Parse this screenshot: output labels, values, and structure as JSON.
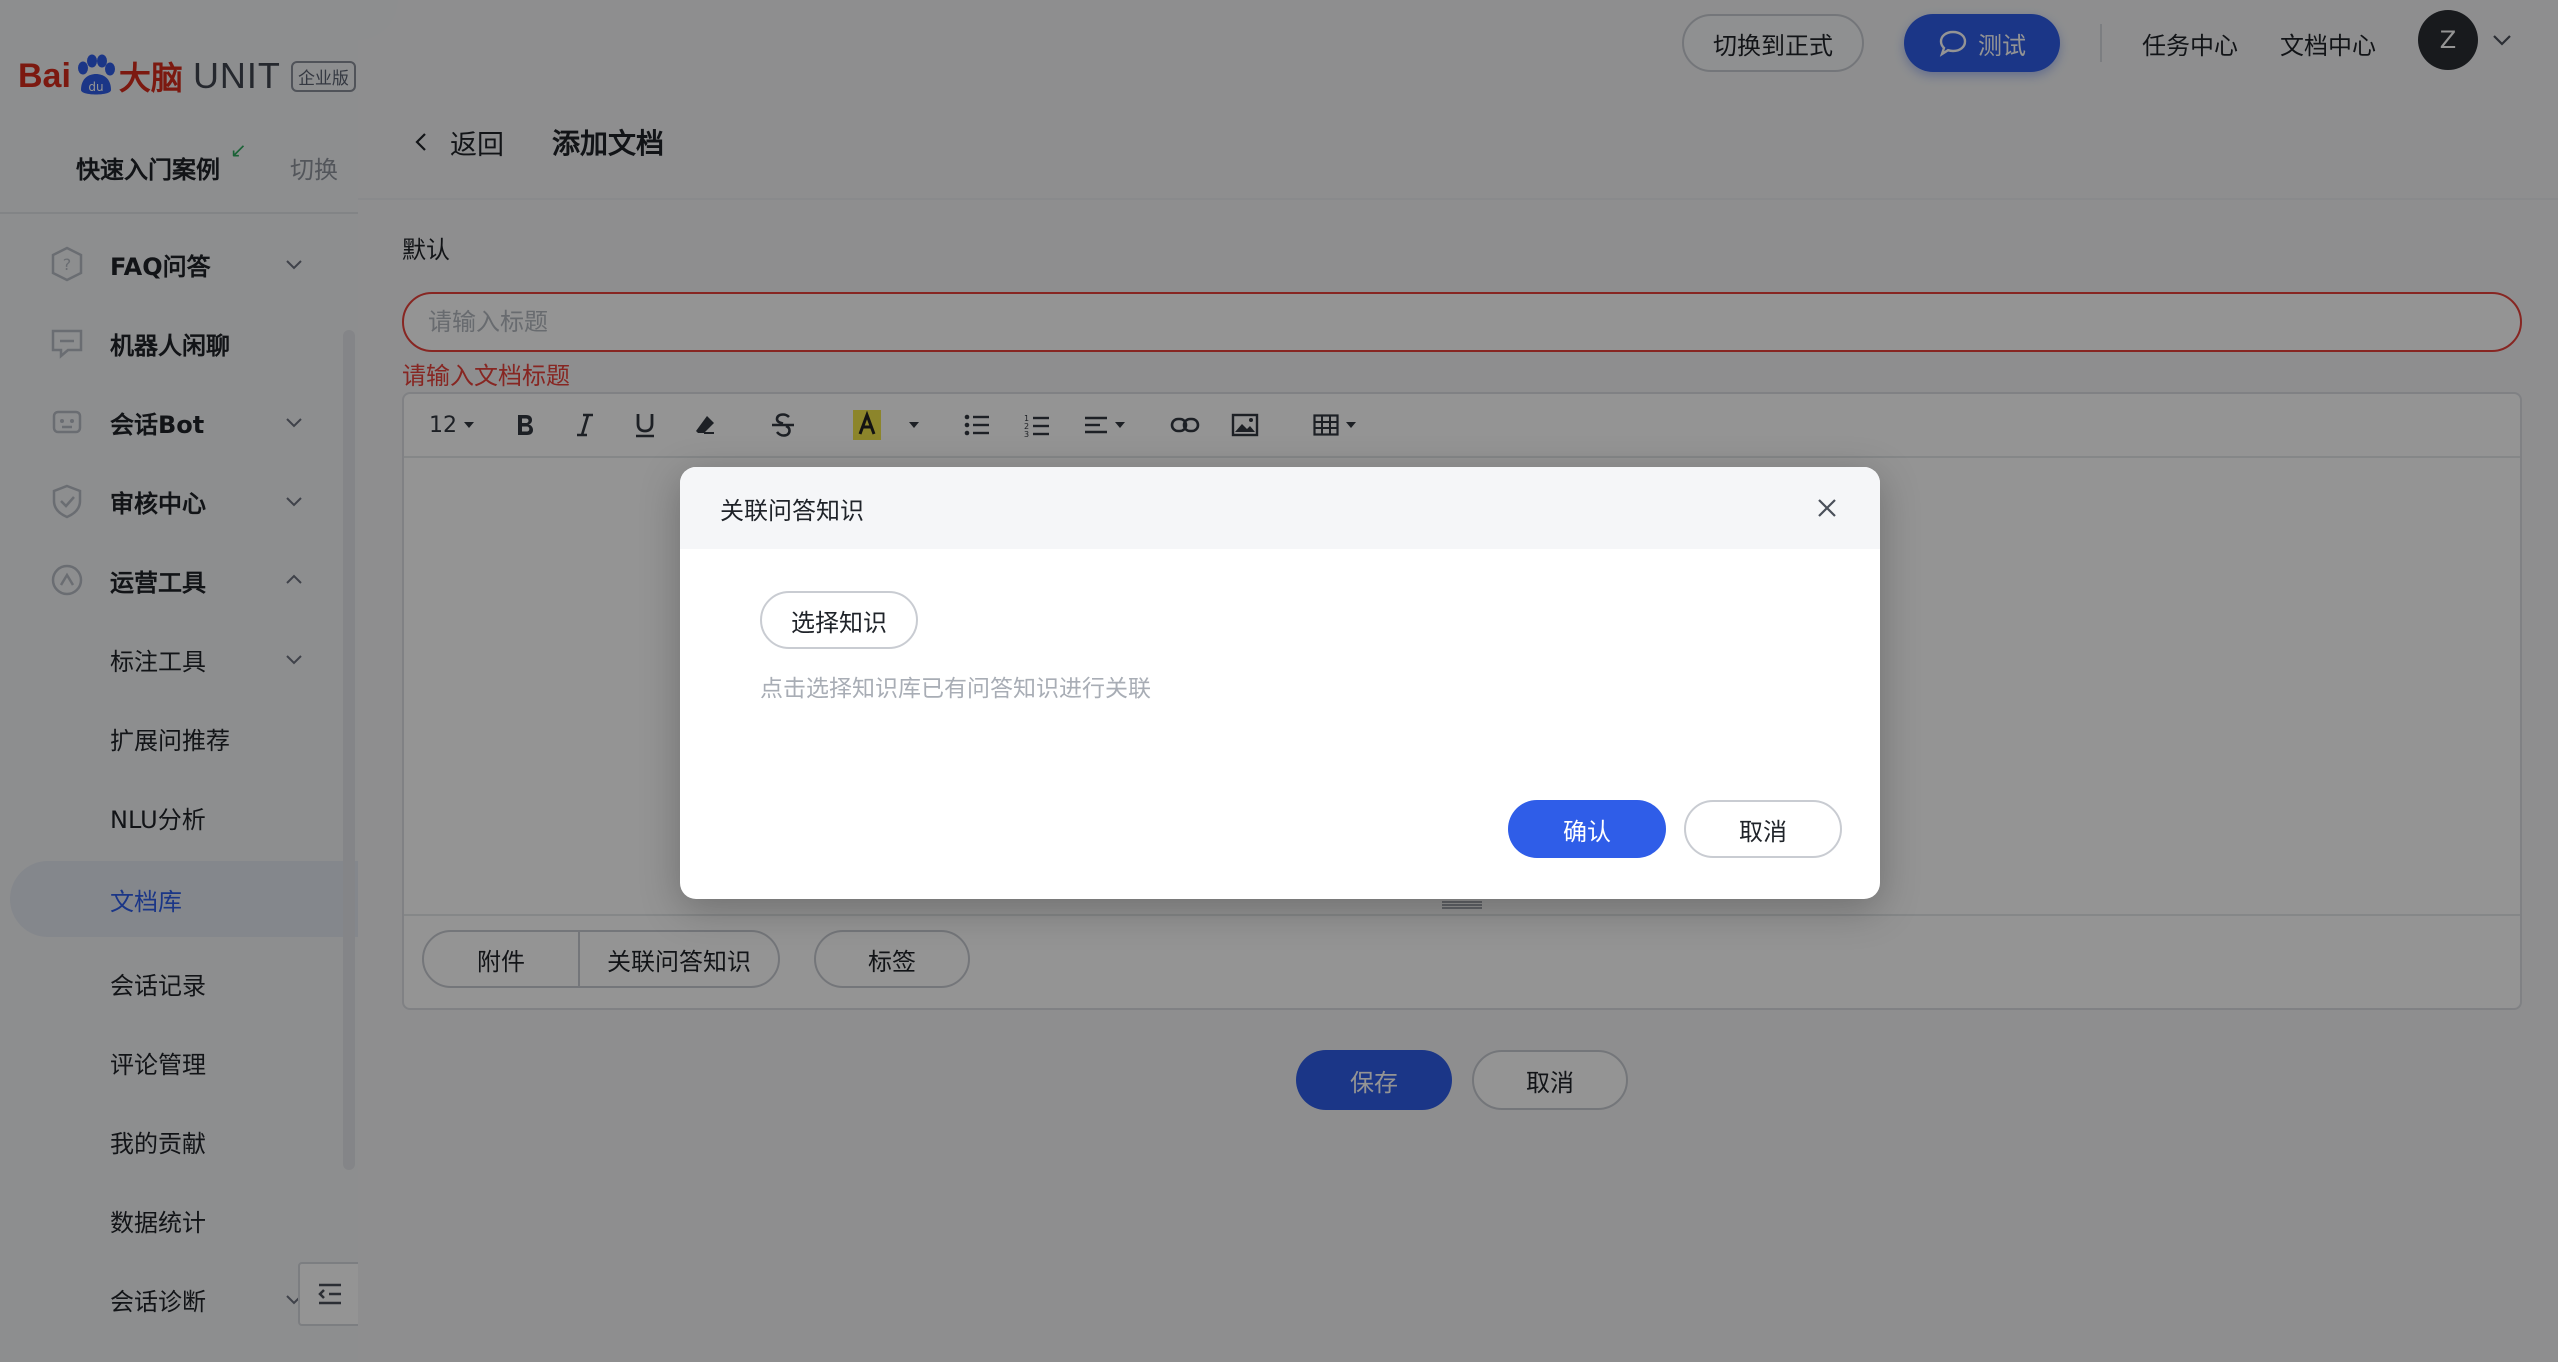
{
  "brand": {
    "bai": "Bai",
    "cn": "大脑",
    "unit": "UNIT",
    "badge": "企业版"
  },
  "quick": {
    "label": "快速入门案例",
    "switch": "切换"
  },
  "sidebar": {
    "items": [
      {
        "label": "FAQ问答",
        "icon": "question-icon"
      },
      {
        "label": "机器人闲聊",
        "icon": "chat-bubble-icon"
      },
      {
        "label": "会话Bot",
        "icon": "robot-icon"
      },
      {
        "label": "审核中心",
        "icon": "shield-icon"
      },
      {
        "label": "运营工具",
        "icon": "tools-icon"
      }
    ],
    "sub_items": [
      {
        "label": "标注工具"
      },
      {
        "label": "扩展问推荐"
      },
      {
        "label": "NLU分析"
      },
      {
        "label": "文档库"
      },
      {
        "label": "会话记录"
      },
      {
        "label": "评论管理"
      },
      {
        "label": "我的贡献"
      },
      {
        "label": "数据统计"
      },
      {
        "label": "会话诊断"
      }
    ]
  },
  "topbar": {
    "switch_label": "切换到正式",
    "test_label": "测试",
    "task_center": "任务中心",
    "doc_center": "文档中心",
    "avatar_letter": "Z"
  },
  "page": {
    "back_label": "返回",
    "title": "添加文档",
    "category": "默认",
    "title_placeholder": "请输入标题",
    "title_error": "请输入文档标题"
  },
  "editor": {
    "font_size": "12",
    "footer": {
      "attachment": "附件",
      "link_qa": "关联问答知识",
      "tag": "标签"
    }
  },
  "actions": {
    "save": "保存",
    "cancel": "取消"
  },
  "modal": {
    "title": "关联问答知识",
    "select_label": "选择知识",
    "hint": "点击选择知识库已有问答知识进行关联",
    "confirm": "确认",
    "cancel": "取消"
  },
  "colors": {
    "primary": "#2f5de8",
    "error": "#e8423b",
    "brand_red": "#d62b1c"
  }
}
